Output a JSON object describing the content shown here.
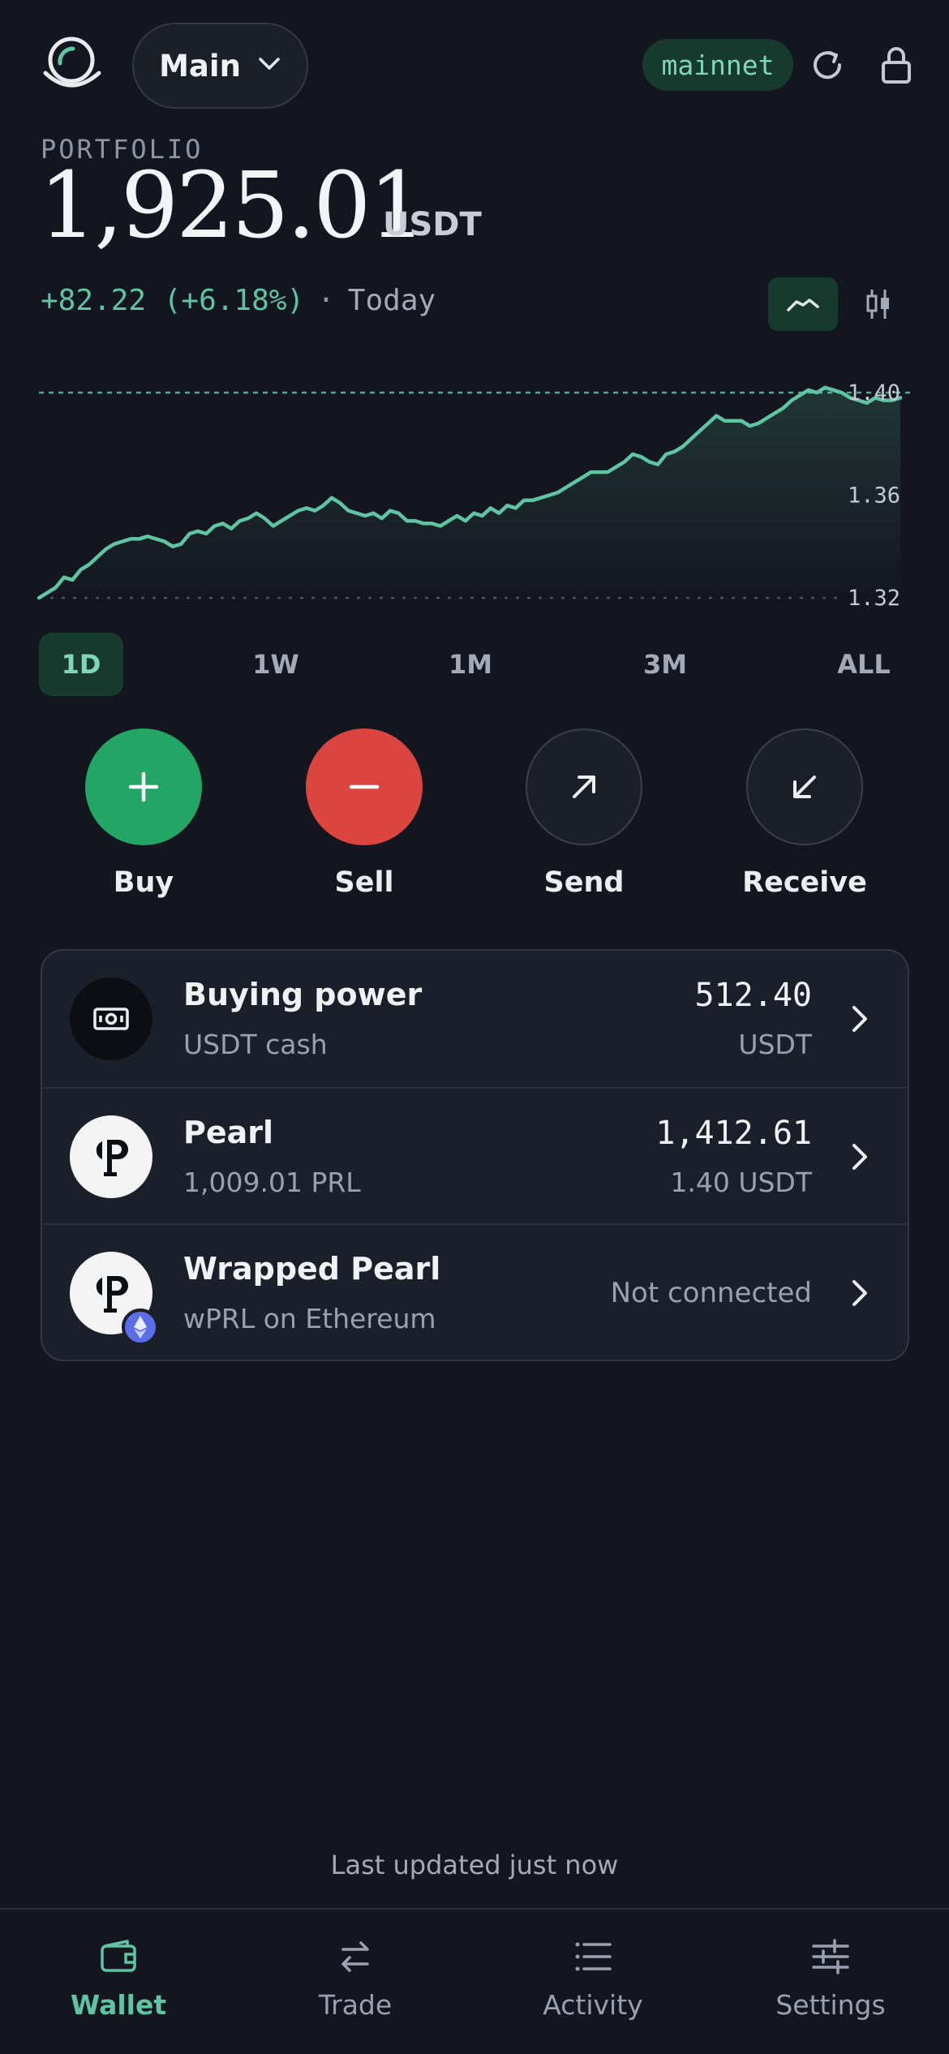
{
  "header": {
    "account_label": "Main",
    "network_badge": "mainnet",
    "icons": {
      "logo": "app-logo",
      "account_chevron": "chevron-down-icon",
      "refresh": "refresh-icon",
      "lock": "lock-icon"
    }
  },
  "portfolio": {
    "label": "PORTFOLIO",
    "value": "1,925.01",
    "unit": "USDT",
    "change": "+82.22 (+6.18%)",
    "separator": "·",
    "period": "Today"
  },
  "colors": {
    "accent": "#5ec4a4",
    "buy": "#22a565",
    "sell": "#dc4440",
    "background": "#13161e"
  },
  "chart_data": {
    "type": "line",
    "y_ticks": [
      "1.40",
      "1.36",
      "1.32"
    ],
    "ylim": [
      1.32,
      1.4
    ],
    "reference_line": 1.4,
    "values": [
      1.32,
      1.322,
      1.324,
      1.328,
      1.327,
      1.331,
      1.333,
      1.336,
      1.339,
      1.341,
      1.342,
      1.343,
      1.343,
      1.344,
      1.343,
      1.342,
      1.34,
      1.341,
      1.345,
      1.346,
      1.345,
      1.348,
      1.349,
      1.347,
      1.35,
      1.351,
      1.353,
      1.351,
      1.348,
      1.35,
      1.352,
      1.354,
      1.355,
      1.354,
      1.356,
      1.359,
      1.357,
      1.354,
      1.353,
      1.352,
      1.353,
      1.351,
      1.354,
      1.353,
      1.35,
      1.35,
      1.349,
      1.349,
      1.348,
      1.35,
      1.352,
      1.35,
      1.353,
      1.352,
      1.355,
      1.353,
      1.356,
      1.355,
      1.358,
      1.358,
      1.359,
      1.36,
      1.361,
      1.363,
      1.365,
      1.367,
      1.369,
      1.369,
      1.369,
      1.371,
      1.373,
      1.376,
      1.375,
      1.373,
      1.372,
      1.376,
      1.377,
      1.379,
      1.382,
      1.385,
      1.388,
      1.391,
      1.389,
      1.389,
      1.389,
      1.387,
      1.388,
      1.39,
      1.392,
      1.394,
      1.397,
      1.399,
      1.401,
      1.4,
      1.402,
      1.401,
      1.4,
      1.398,
      1.397,
      1.396,
      1.398,
      1.397,
      1.397,
      1.398
    ],
    "x_range_selected": "1D"
  },
  "ranges": [
    {
      "label": "1D",
      "active": true
    },
    {
      "label": "1W",
      "active": false
    },
    {
      "label": "1M",
      "active": false
    },
    {
      "label": "3M",
      "active": false
    },
    {
      "label": "ALL",
      "active": false
    }
  ],
  "actions": [
    {
      "label": "Buy",
      "icon": "plus-icon"
    },
    {
      "label": "Sell",
      "icon": "minus-icon"
    },
    {
      "label": "Send",
      "icon": "arrow-up-right-icon"
    },
    {
      "label": "Receive",
      "icon": "arrow-down-left-icon"
    }
  ],
  "assets": [
    {
      "name": "Buying power",
      "sub": "USDT cash",
      "amount": "512.40",
      "amount_sub": "USDT",
      "icon": "cash-icon"
    },
    {
      "name": "Pearl",
      "sub": "1,009.01 PRL",
      "amount": "1,412.61",
      "amount_sub": "1.40 USDT",
      "icon": "pearl-logo-icon"
    },
    {
      "name": "Wrapped Pearl",
      "sub": "wPRL on Ethereum",
      "status": "Not connected",
      "icon": "wrapped-pearl-icon",
      "badge": "ethereum-icon"
    }
  ],
  "footer": {
    "last_updated": "Last updated just now"
  },
  "nav": [
    {
      "label": "Wallet",
      "icon": "wallet-icon",
      "active": true
    },
    {
      "label": "Trade",
      "icon": "swap-icon",
      "active": false
    },
    {
      "label": "Activity",
      "icon": "list-icon",
      "active": false
    },
    {
      "label": "Settings",
      "icon": "sliders-icon",
      "active": false
    }
  ]
}
